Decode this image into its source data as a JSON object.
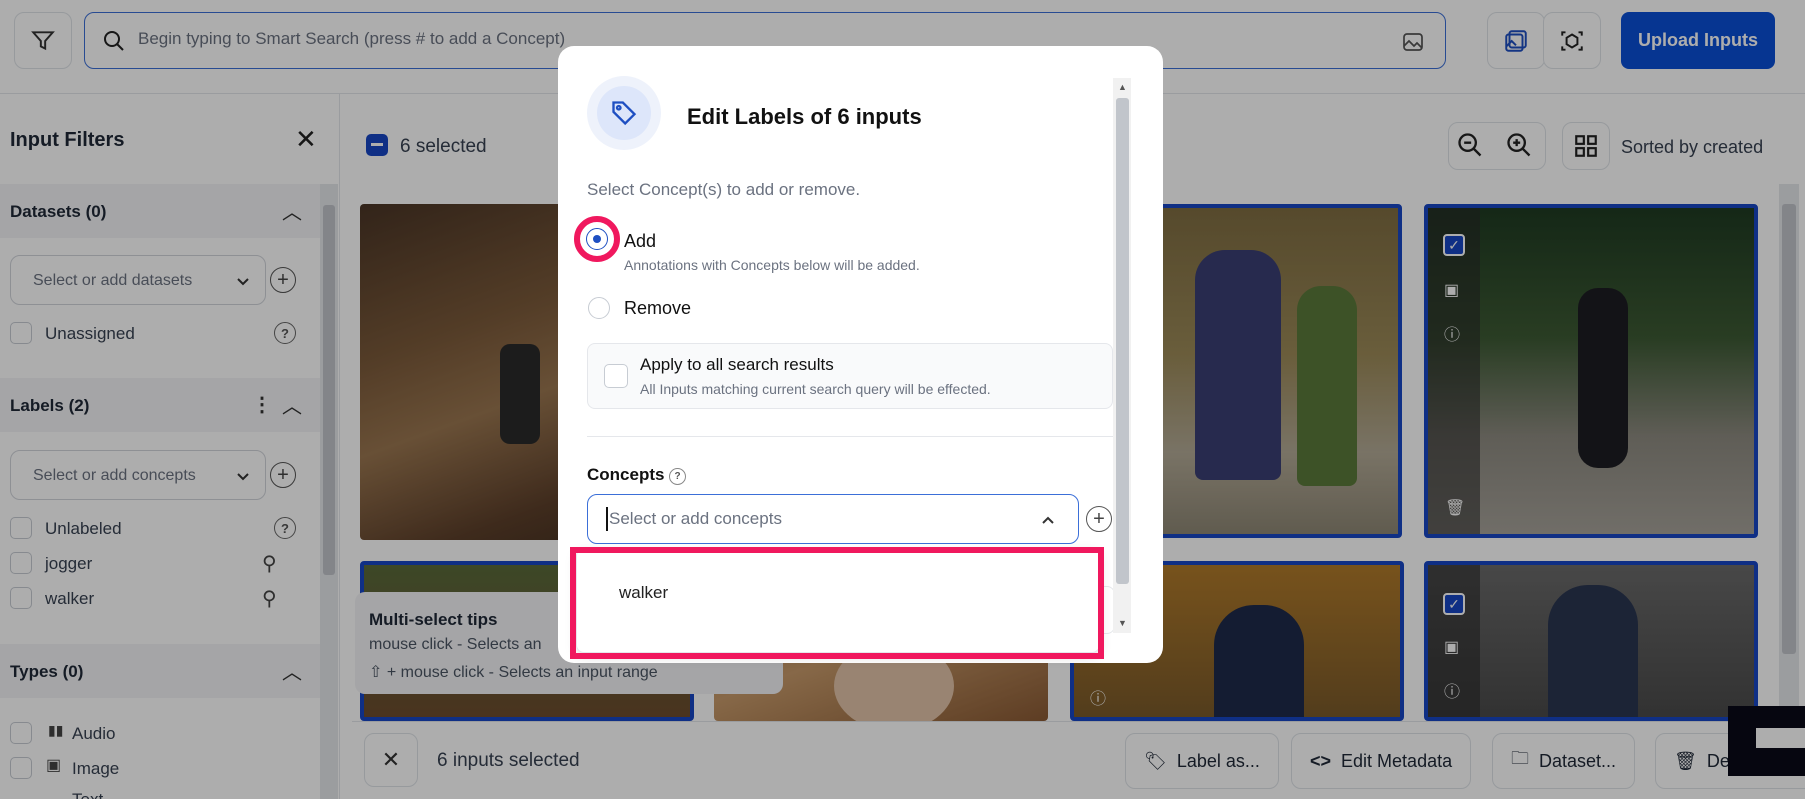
{
  "header": {
    "search_placeholder": "Begin typing to Smart Search (press # to add a Concept)",
    "upload_label": "Upload Inputs"
  },
  "sidebar": {
    "title": "Input Filters",
    "datasets": {
      "title": "Datasets (0)",
      "placeholder": "Select or add datasets",
      "items": [
        "Unassigned"
      ]
    },
    "labels": {
      "title": "Labels (2)",
      "placeholder": "Select or add concepts",
      "items": [
        "Unlabeled",
        "jogger",
        "walker"
      ]
    },
    "types": {
      "title": "Types (0)",
      "items": [
        "Audio",
        "Image",
        "Text"
      ]
    }
  },
  "toolbar": {
    "selected_label": "6 selected",
    "sort_label": "Sorted by created"
  },
  "tips": {
    "title": "Multi-select tips",
    "line1": "mouse click - Selects an",
    "line2": "⇧ + mouse click - Selects an input range"
  },
  "bottom_bar": {
    "count_label": "6 inputs selected",
    "label_as": "Label as...",
    "edit_metadata": "Edit Metadata",
    "dataset": "Dataset...",
    "delete": "De"
  },
  "modal": {
    "title": "Edit Labels of 6 inputs",
    "subtitle": "Select Concept(s) to add or remove.",
    "add_label": "Add",
    "add_desc": "Annotations with Concepts below will be added.",
    "remove_label": "Remove",
    "apply_all_label": "Apply to all search results",
    "apply_all_desc": "All Inputs matching current search query will be effected.",
    "concepts_label": "Concepts",
    "concepts_placeholder": "Select or add concepts",
    "dropdown_options": [
      "walker"
    ]
  },
  "colors": {
    "accent": "#0a4fd6",
    "selection_border": "#1746c5",
    "highlight": "#f0185e"
  }
}
